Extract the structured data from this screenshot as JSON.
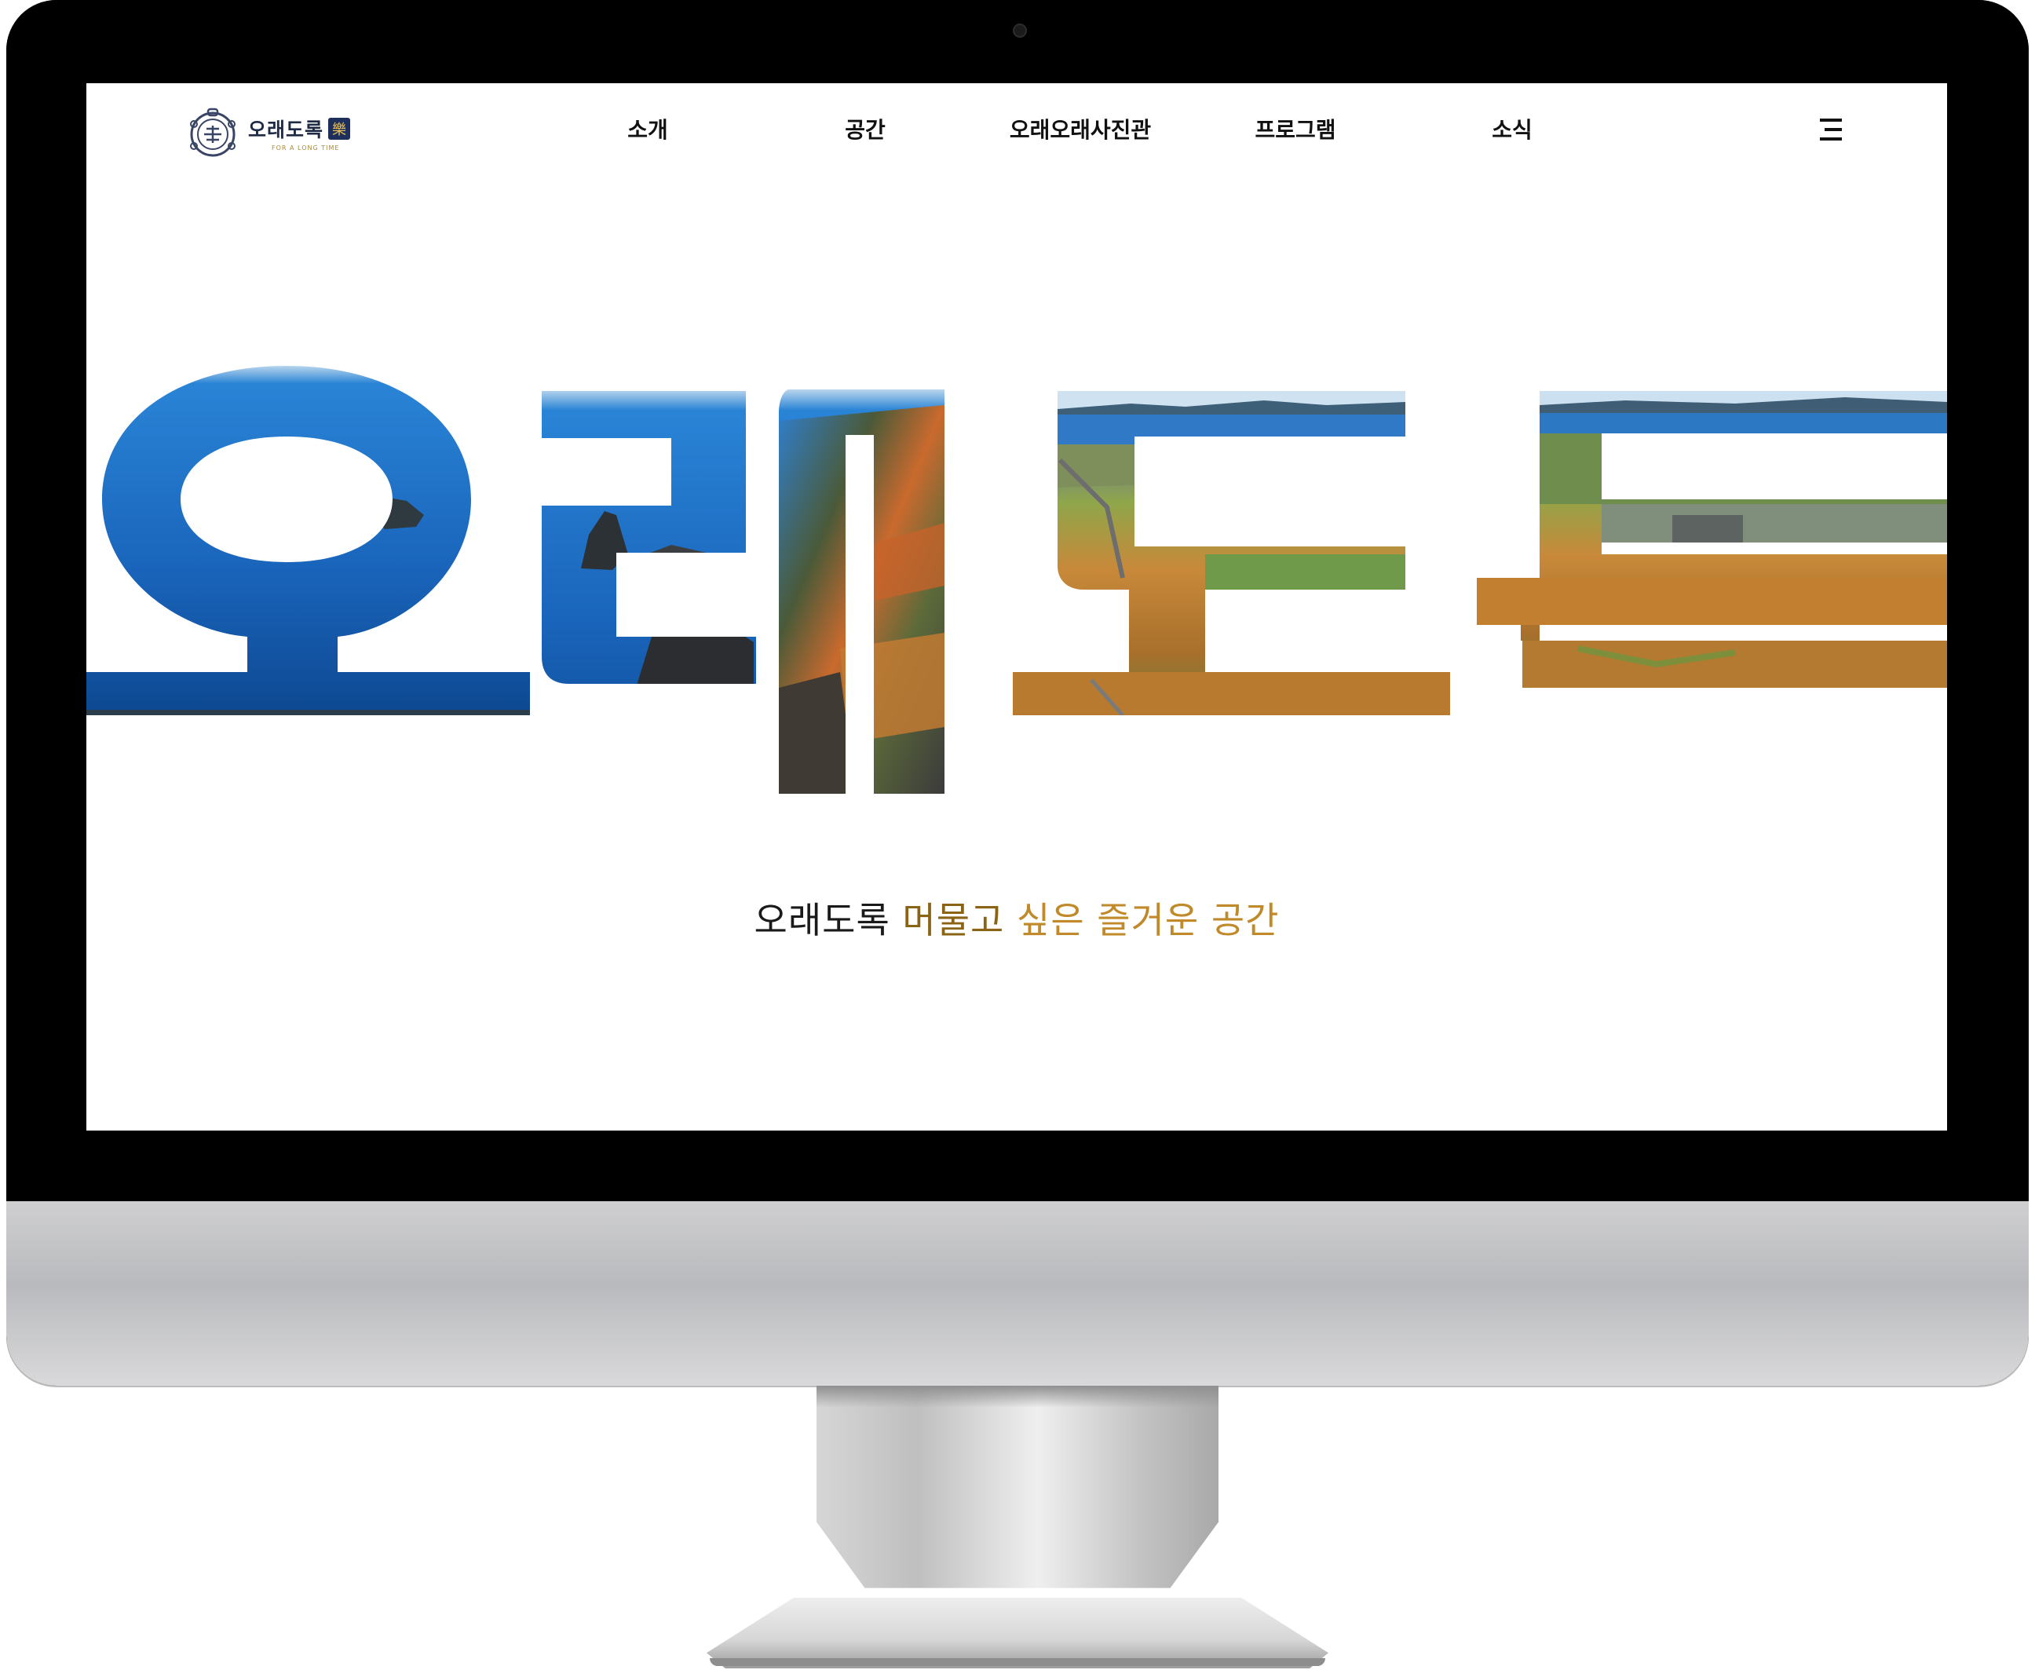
{
  "brand": {
    "name": "오래도록",
    "seal_char": "樂",
    "subtitle": "FOR A LONG TIME"
  },
  "nav": {
    "items": [
      {
        "label": "소개"
      },
      {
        "label": "공간"
      },
      {
        "label": "오래오래사진관"
      },
      {
        "label": "프로그램"
      },
      {
        "label": "소식"
      }
    ]
  },
  "menu": {
    "icon": "hamburger-menu-icon"
  },
  "hero": {
    "title": "오래도록"
  },
  "tagline": {
    "part1": "오래도록",
    "part2": "머물고",
    "part3": "싶은 즐거운 공간"
  },
  "colors": {
    "ocean": "#1e6fc0",
    "deep_ocean": "#0b3f86",
    "sky": "#cfe4f3",
    "grass": "#c98a2e",
    "green": "#5f8a3a",
    "tag_brown": "#8a6414",
    "tag_gold": "#c08a2a"
  }
}
